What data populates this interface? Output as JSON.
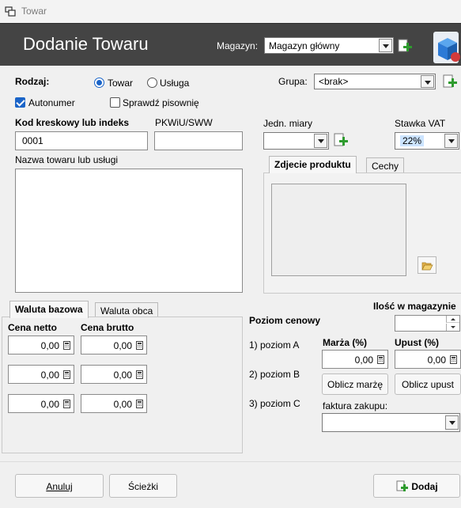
{
  "window": {
    "title": "Towar"
  },
  "header": {
    "title": "Dodanie Towaru",
    "magazyn_label": "Magazyn:",
    "magazyn_value": "Magazyn główny"
  },
  "form": {
    "rodzaj_label": "Rodzaj:",
    "towar_label": "Towar",
    "towar_selected": true,
    "usluga_label": "Usługa",
    "grupa_label": "Grupa:",
    "grupa_value": "<brak>",
    "autonumer_label": "Autonumer",
    "autonumer_checked": true,
    "spell_label": "Sprawdź pisownię",
    "spell_checked": false,
    "kod_label": "Kod kreskowy lub indeks",
    "kod_value": "0001",
    "pkwiu_label": "PKWiU/SWW",
    "pkwiu_value": "",
    "jedn_label": "Jedn. miary",
    "jedn_value": "",
    "vat_label": "Stawka VAT",
    "vat_value": "22%",
    "nazwa_label": "Nazwa towaru lub usługi",
    "nazwa_value": ""
  },
  "product_tabs": [
    {
      "label": "Zdjecie produktu",
      "active": true
    },
    {
      "label": "Cechy",
      "active": false
    }
  ],
  "currency_tabs": [
    {
      "label": "Waluta bazowa",
      "active": true
    },
    {
      "label": "Waluta obca",
      "active": false
    }
  ],
  "pricing": {
    "cena_netto_label": "Cena netto",
    "cena_brutto_label": "Cena brutto",
    "rows": [
      {
        "netto": "0,00",
        "brutto": "0,00",
        "level": "1) poziom A"
      },
      {
        "netto": "0,00",
        "brutto": "0,00",
        "level": "2) poziom B"
      },
      {
        "netto": "0,00",
        "brutto": "0,00",
        "level": "3) poziom C"
      }
    ],
    "poziom_label": "Poziom cenowy",
    "marza_label": "Marża (%)",
    "marza_value": "0,00",
    "upust_label": "Upust (%)",
    "upust_value": "0,00",
    "oblicz_marze_label": "Oblicz marżę",
    "oblicz_upust_label": "Oblicz upust",
    "faktura_label": "faktura zakupu:",
    "faktura_value": "",
    "ilosc_label": "Ilość w magazynie",
    "ilosc_value": ""
  },
  "footer": {
    "anuluj_label": "Anuluj",
    "sciezki_label": "Ścieżki",
    "dodaj_label": "Dodaj"
  },
  "colors": {
    "header_bg": "#444444",
    "accent": "#1a64c8",
    "vat_highlight": "#cce4ff"
  }
}
